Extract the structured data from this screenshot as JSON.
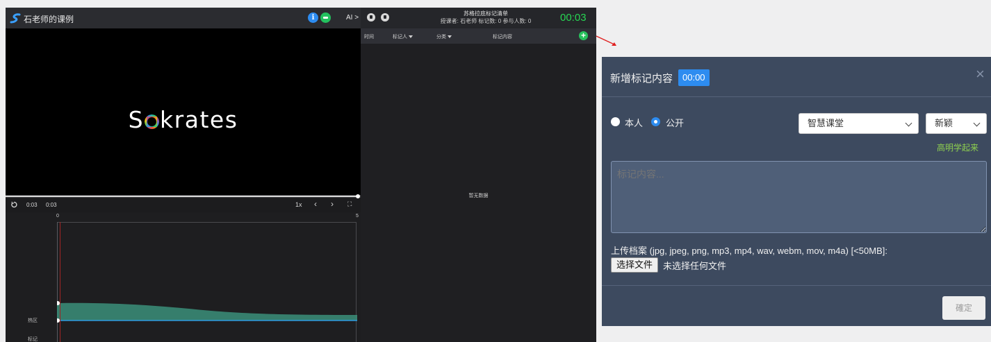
{
  "player": {
    "title": "石老师的课例",
    "ai_toggle": "AI >",
    "brand": {
      "before": "S",
      "after": "krates"
    },
    "controls": {
      "current": "0:03",
      "duration": "0:03",
      "speed": "1x",
      "prev": "‹",
      "next": "›",
      "fullscreen": "⛶"
    },
    "timeline": {
      "start": "0",
      "end": "5",
      "rows": [
        "热区",
        "标记"
      ]
    },
    "progress": 0.99
  },
  "list": {
    "title": "苏格拉底标记清单",
    "subtitle": "授课者: 石老师 标记数: 0 参与人数: 0",
    "timer": "00:03",
    "columns": [
      "时间",
      "标记人",
      "分类",
      "标记内容"
    ],
    "empty": "暂无数据",
    "add": "+"
  },
  "dialog": {
    "title": "新增标记内容",
    "time": "00:00",
    "close": "×",
    "visibility": {
      "private": "本人",
      "public": "公开",
      "selected": "public"
    },
    "category": "智慧课堂",
    "tag": "新颖",
    "user": "高明学起来",
    "placeholder": "标记内容...",
    "upload_label": "上传档案 (jpg, jpeg, png, mp3, mp4, wav, webm, mov, m4a) [<50MB]:",
    "file_button": "选择文件",
    "file_none": "未选择任何文件",
    "confirm": "確定"
  },
  "colors": {
    "accent": "#2d8cf0",
    "timer": "#27d653",
    "add": "#27c15c",
    "user": "#8fd14f",
    "dialog_bg": "#3d4a5f"
  }
}
